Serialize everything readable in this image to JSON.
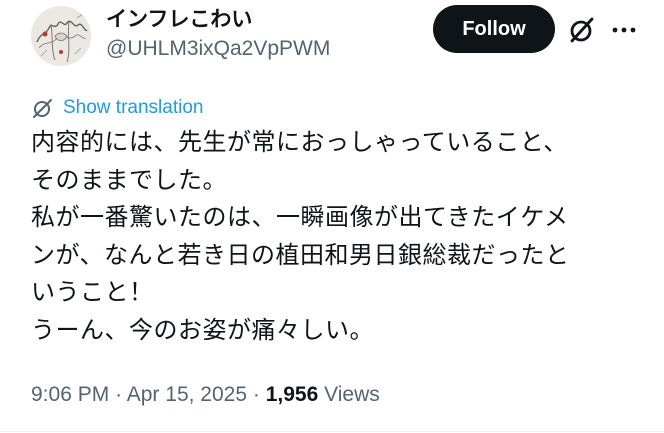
{
  "author": {
    "display_name": "インフレこわい",
    "handle": "@UHLM3ixQa2VpPWM",
    "avatar_icon": "avatar-sketch-portrait"
  },
  "header": {
    "follow_label": "Follow",
    "grok_icon": "grok-icon",
    "more_icon": "more-options-icon"
  },
  "translation": {
    "icon": "translate-globe-icon",
    "label": "Show translation"
  },
  "tweet": {
    "lines": [
      "内容的には、先生が常におっしゃっていること、",
      "そのままでした。",
      "私が一番驚いたのは、一瞬画像が出てきたイケメ",
      "ンが、なんと若き日の植田和男日銀総裁だったと",
      "いうこと！",
      "うーん、今のお姿が痛々しい。"
    ]
  },
  "meta": {
    "time": "9:06 PM",
    "separator": "·",
    "date": "Apr 15, 2025",
    "views_count": "1,956",
    "views_label": "Views"
  },
  "colors": {
    "text_primary": "#0f1419",
    "text_secondary": "#536471",
    "link_blue": "#1d9bf0",
    "follow_bg": "#0f1419",
    "follow_text": "#ffffff"
  }
}
